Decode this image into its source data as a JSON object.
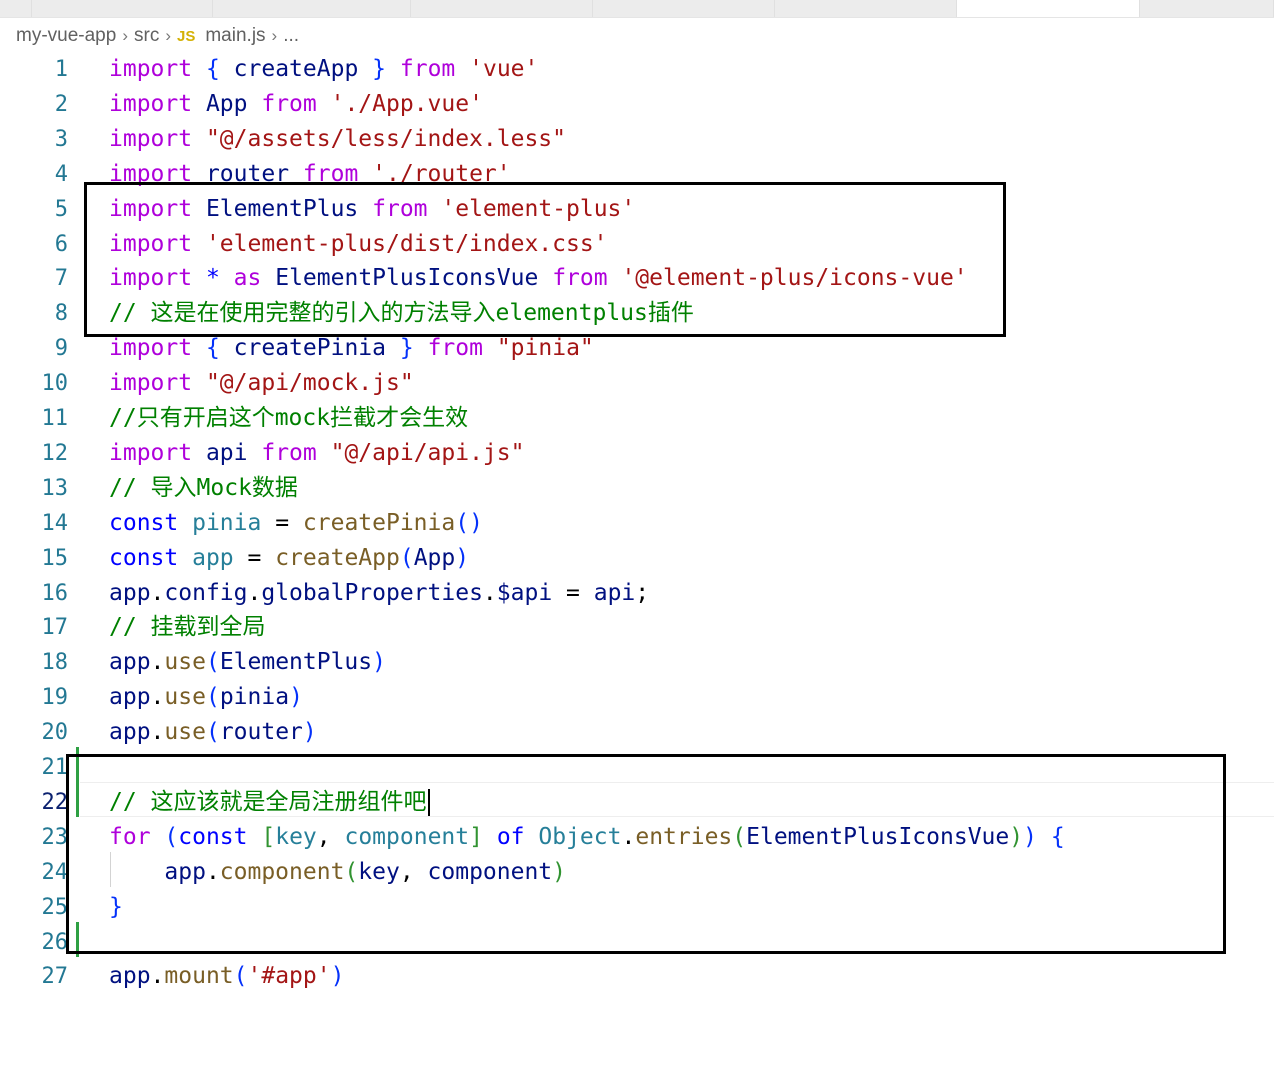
{
  "editor": {
    "breadcrumb": [
      "my-vue-app",
      "src",
      "main.js",
      "..."
    ],
    "file_icon": "JS",
    "cursor_line": 22
  },
  "code": {
    "lines": [
      [
        [
          "c",
          "import"
        ],
        [
          "p",
          " "
        ],
        [
          "b1",
          "{"
        ],
        [
          "p",
          " "
        ],
        [
          "v",
          "createApp"
        ],
        [
          "p",
          " "
        ],
        [
          "b1",
          "}"
        ],
        [
          "p",
          " "
        ],
        [
          "c",
          "from"
        ],
        [
          "p",
          " "
        ],
        [
          "s",
          "'vue'"
        ]
      ],
      [
        [
          "c",
          "import"
        ],
        [
          "p",
          " "
        ],
        [
          "v",
          "App"
        ],
        [
          "p",
          " "
        ],
        [
          "c",
          "from"
        ],
        [
          "p",
          " "
        ],
        [
          "s",
          "'./App.vue'"
        ]
      ],
      [
        [
          "c",
          "import"
        ],
        [
          "p",
          " "
        ],
        [
          "s",
          "\"@/assets/less/index.less\""
        ]
      ],
      [
        [
          "c",
          "import"
        ],
        [
          "p",
          " "
        ],
        [
          "v",
          "router"
        ],
        [
          "p",
          " "
        ],
        [
          "c",
          "from"
        ],
        [
          "p",
          " "
        ],
        [
          "s",
          "'./router'"
        ]
      ],
      [
        [
          "c",
          "import"
        ],
        [
          "p",
          " "
        ],
        [
          "v",
          "ElementPlus"
        ],
        [
          "p",
          " "
        ],
        [
          "c",
          "from"
        ],
        [
          "p",
          " "
        ],
        [
          "s",
          "'element-plus'"
        ]
      ],
      [
        [
          "c",
          "import"
        ],
        [
          "p",
          " "
        ],
        [
          "s",
          "'element-plus/dist/index.css'"
        ]
      ],
      [
        [
          "c",
          "import"
        ],
        [
          "p",
          " "
        ],
        [
          "k",
          "*"
        ],
        [
          "p",
          " "
        ],
        [
          "c",
          "as"
        ],
        [
          "p",
          " "
        ],
        [
          "v",
          "ElementPlusIconsVue"
        ],
        [
          "p",
          " "
        ],
        [
          "c",
          "from"
        ],
        [
          "p",
          " "
        ],
        [
          "s",
          "'@element-plus/icons-vue'"
        ]
      ],
      [
        [
          "cm",
          "// 这是在使用完整的引入的方法导入elementplus插件"
        ]
      ],
      [
        [
          "c",
          "import"
        ],
        [
          "p",
          " "
        ],
        [
          "b1",
          "{"
        ],
        [
          "p",
          " "
        ],
        [
          "v",
          "createPinia"
        ],
        [
          "p",
          " "
        ],
        [
          "b1",
          "}"
        ],
        [
          "p",
          " "
        ],
        [
          "c",
          "from"
        ],
        [
          "p",
          " "
        ],
        [
          "s",
          "\"pinia\""
        ]
      ],
      [
        [
          "c",
          "import"
        ],
        [
          "p",
          " "
        ],
        [
          "s",
          "\"@/api/mock.js\""
        ]
      ],
      [
        [
          "cm",
          "//只有开启这个mock拦截才会生效"
        ]
      ],
      [
        [
          "c",
          "import"
        ],
        [
          "p",
          " "
        ],
        [
          "v",
          "api"
        ],
        [
          "p",
          " "
        ],
        [
          "c",
          "from"
        ],
        [
          "p",
          " "
        ],
        [
          "s",
          "\"@/api/api.js\""
        ]
      ],
      [
        [
          "cm",
          "// 导入Mock数据"
        ]
      ],
      [
        [
          "k",
          "const"
        ],
        [
          "p",
          " "
        ],
        [
          "t",
          "pinia"
        ],
        [
          "p",
          " = "
        ],
        [
          "f",
          "createPinia"
        ],
        [
          "b1",
          "()"
        ]
      ],
      [
        [
          "k",
          "const"
        ],
        [
          "p",
          " "
        ],
        [
          "t",
          "app"
        ],
        [
          "p",
          " = "
        ],
        [
          "f",
          "createApp"
        ],
        [
          "b1",
          "("
        ],
        [
          "v",
          "App"
        ],
        [
          "b1",
          ")"
        ]
      ],
      [
        [
          "v",
          "app"
        ],
        [
          "p",
          "."
        ],
        [
          "v",
          "config"
        ],
        [
          "p",
          "."
        ],
        [
          "v",
          "globalProperties"
        ],
        [
          "p",
          "."
        ],
        [
          "v",
          "$api"
        ],
        [
          "p",
          " = "
        ],
        [
          "v",
          "api"
        ],
        [
          "p",
          ";"
        ]
      ],
      [
        [
          "cm",
          "// 挂载到全局"
        ]
      ],
      [
        [
          "v",
          "app"
        ],
        [
          "p",
          "."
        ],
        [
          "f",
          "use"
        ],
        [
          "b1",
          "("
        ],
        [
          "v",
          "ElementPlus"
        ],
        [
          "b1",
          ")"
        ]
      ],
      [
        [
          "v",
          "app"
        ],
        [
          "p",
          "."
        ],
        [
          "f",
          "use"
        ],
        [
          "b1",
          "("
        ],
        [
          "v",
          "pinia"
        ],
        [
          "b1",
          ")"
        ]
      ],
      [
        [
          "v",
          "app"
        ],
        [
          "p",
          "."
        ],
        [
          "f",
          "use"
        ],
        [
          "b1",
          "("
        ],
        [
          "v",
          "router"
        ],
        [
          "b1",
          ")"
        ]
      ],
      [],
      [
        [
          "cm",
          "// 这应该就是全局注册组件吧"
        ]
      ],
      [
        [
          "c",
          "for"
        ],
        [
          "p",
          " "
        ],
        [
          "b1",
          "("
        ],
        [
          "k",
          "const"
        ],
        [
          "p",
          " "
        ],
        [
          "b2",
          "["
        ],
        [
          "t",
          "key"
        ],
        [
          "p",
          ", "
        ],
        [
          "t",
          "component"
        ],
        [
          "b2",
          "]"
        ],
        [
          "p",
          " "
        ],
        [
          "k",
          "of"
        ],
        [
          "p",
          " "
        ],
        [
          "t",
          "Object"
        ],
        [
          "p",
          "."
        ],
        [
          "f",
          "entries"
        ],
        [
          "b2",
          "("
        ],
        [
          "v",
          "ElementPlusIconsVue"
        ],
        [
          "b2",
          ")"
        ],
        [
          "b1",
          ")"
        ],
        [
          "p",
          " "
        ],
        [
          "b1",
          "{"
        ]
      ],
      [
        [
          "p",
          "    "
        ],
        [
          "v",
          "app"
        ],
        [
          "p",
          "."
        ],
        [
          "f",
          "component"
        ],
        [
          "b2",
          "("
        ],
        [
          "v",
          "key"
        ],
        [
          "p",
          ", "
        ],
        [
          "v",
          "component"
        ],
        [
          "b2",
          ")"
        ]
      ],
      [
        [
          "b1",
          "}"
        ]
      ],
      [],
      [
        [
          "v",
          "app"
        ],
        [
          "p",
          "."
        ],
        [
          "f",
          "mount"
        ],
        [
          "b1",
          "("
        ],
        [
          "s",
          "'#app'"
        ],
        [
          "b1",
          ")"
        ]
      ]
    ]
  },
  "colors": {
    "keyword_control": "#af00db",
    "keyword": "#0000ff",
    "string": "#a31515",
    "variable": "#001080",
    "function": "#795e26",
    "type": "#267f99",
    "comment": "#008000",
    "line_number": "#237893",
    "git_added": "#2ea043"
  }
}
